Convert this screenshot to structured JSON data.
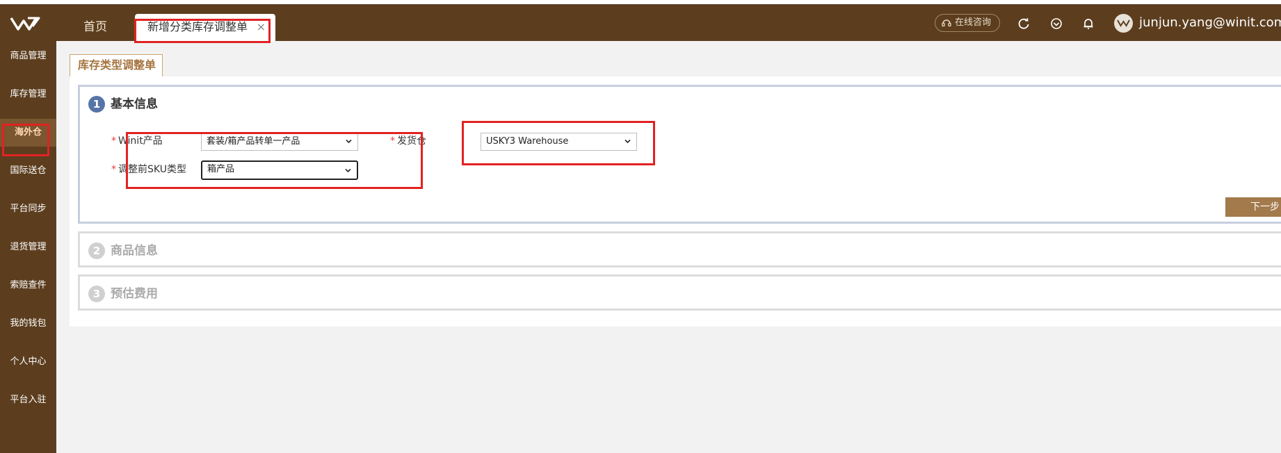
{
  "header": {
    "tabs": [
      {
        "label": "首页"
      },
      {
        "label": "新增分类库存调整单",
        "close": "×"
      }
    ],
    "consult_label": "在线咨询",
    "user_email": "junjun.yang@winit.com.cn"
  },
  "sidebar": {
    "items": [
      {
        "label": "商品管理"
      },
      {
        "label": "库存管理"
      },
      {
        "label": "海外仓",
        "selected": true
      },
      {
        "label": "国际送仓"
      },
      {
        "label": "平台同步"
      },
      {
        "label": "退货管理"
      },
      {
        "label": "索赔查件"
      },
      {
        "label": "我的钱包"
      },
      {
        "label": "个人中心"
      },
      {
        "label": "平台入驻"
      }
    ]
  },
  "page_tab": "库存类型调整单",
  "sections": [
    {
      "num": "1",
      "title": "基本信息"
    },
    {
      "num": "2",
      "title": "商品信息"
    },
    {
      "num": "3",
      "title": "预估费用"
    }
  ],
  "form": {
    "required_mark": "*",
    "product_label": "Winit产品",
    "product_value": "套装/箱产品转单一产品",
    "warehouse_label": "发货仓",
    "warehouse_value": "USKY3 Warehouse",
    "sku_type_label": "调整前SKU类型",
    "sku_type_value": "箱产品"
  },
  "next_button": "下一步",
  "colors": {
    "brand_dark": "#5c3e1f",
    "accent": "#a37a4b",
    "step_active": "#5674a6",
    "highlight": "#e22222"
  }
}
